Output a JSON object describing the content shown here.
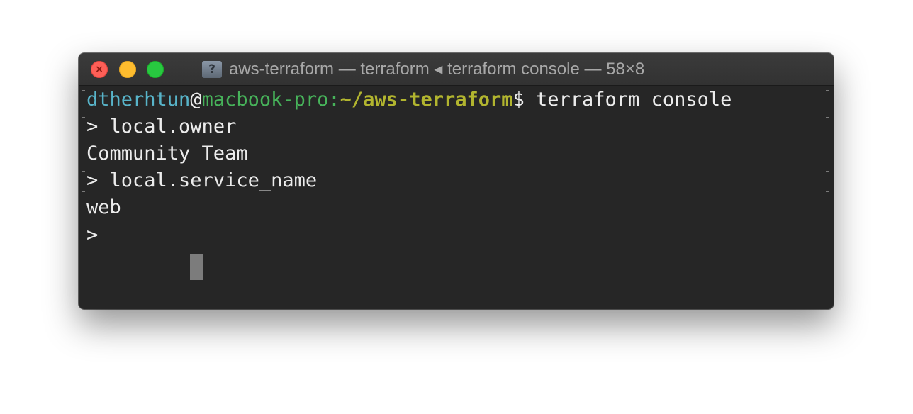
{
  "window": {
    "title": "aws-terraform — terraform ◂ terraform console — 58×8",
    "title_icon": "unknown-document-icon",
    "traffic_lights": {
      "close": "#fe5f57",
      "minimize": "#febc2e",
      "zoom": "#28c840"
    }
  },
  "colors": {
    "background": "#262626",
    "text": "#ececec",
    "user": "#58b4c9",
    "host": "#47b35a",
    "path": "#b2b52f",
    "cursor": "#7c7c7c"
  },
  "terminal": {
    "prompt": {
      "user": "dtherhtun",
      "at": "@",
      "host": "macbook-pro",
      "colon": ":",
      "path": "~/aws-terraform",
      "symbol": "$",
      "command": " terraform console"
    },
    "lines": [
      {
        "prefix": "> ",
        "text": "local.owner"
      },
      {
        "text": "Community Team"
      },
      {
        "prefix": "> ",
        "text": "local.service_name"
      },
      {
        "text": "web"
      },
      {
        "prefix": "> ",
        "text": ""
      }
    ]
  }
}
